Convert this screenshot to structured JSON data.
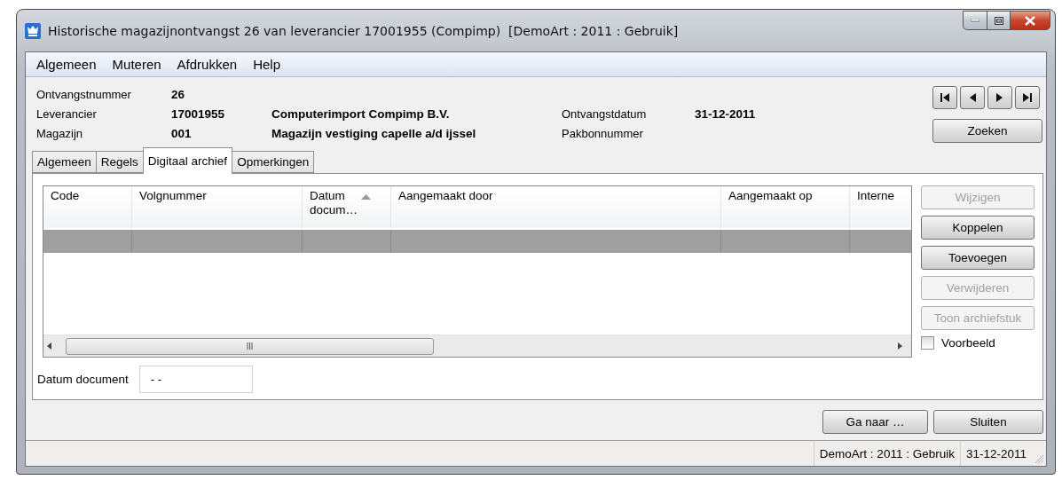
{
  "window": {
    "title": "Historische magazijnontvangst 26 van leverancier 17001955 (Compimp)  [DemoArt : 2011 : Gebruik]"
  },
  "menu": [
    "Algemeen",
    "Muteren",
    "Afdrukken",
    "Help"
  ],
  "header": {
    "fields": [
      {
        "label": "Ontvangstnummer",
        "value": "26"
      },
      {
        "label": "Leverancier",
        "value": "17001955",
        "description": "Computerimport Compimp B.V."
      },
      {
        "label": "Magazijn",
        "value": "001",
        "description": "Magazijn vestiging capelle a/d ijssel"
      }
    ],
    "side_fields": [
      {
        "label": "Ontvangstdatum",
        "value": "31-12-2011"
      },
      {
        "label": "Pakbonnummer"
      }
    ]
  },
  "navigation": {
    "search_button": "Zoeken"
  },
  "tabs": [
    {
      "label": "Algemeen",
      "selected": false
    },
    {
      "label": "Regels",
      "selected": false
    },
    {
      "label": "Digitaal archief",
      "selected": true
    },
    {
      "label": "Opmerkingen",
      "selected": false
    }
  ],
  "table": {
    "columns": [
      {
        "label": "Code",
        "sorted": false
      },
      {
        "label": "Volgnummer",
        "sorted": false
      },
      {
        "label": "Datum\ndocum…",
        "sorted": true
      },
      {
        "label": "Aangemaakt door",
        "sorted": false
      },
      {
        "label": "Aangemaakt op",
        "sorted": false
      },
      {
        "label": "Interne",
        "sorted": false
      }
    ],
    "rows": [
      {
        "selected": true
      }
    ]
  },
  "side_buttons": [
    {
      "label": "Wijzigen",
      "disabled": true
    },
    {
      "label": "Koppelen",
      "disabled": false
    },
    {
      "label": "Toevoegen",
      "disabled": false
    },
    {
      "label": "Verwijderen",
      "disabled": true
    },
    {
      "label": "Toon archiefstuk",
      "disabled": true
    }
  ],
  "preview": {
    "label": "Voorbeeld",
    "checked": false
  },
  "date_field": {
    "label": "Datum document",
    "value": "- -"
  },
  "footer_buttons": [
    "Ga naar …",
    "Sluiten"
  ],
  "status_bar": [
    "DemoArt : 2011 : Gebruik",
    "31-12-2011"
  ]
}
